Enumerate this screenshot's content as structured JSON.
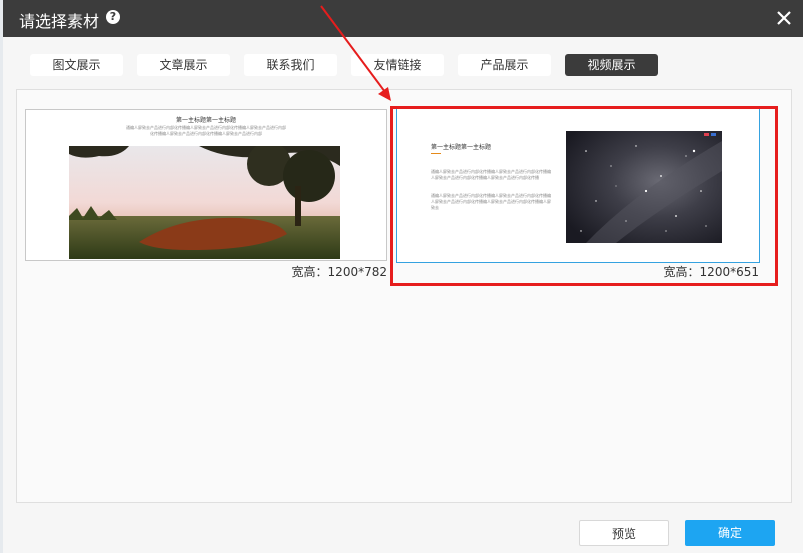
{
  "dialog": {
    "title": "请选择素材",
    "help_glyph": "?",
    "close_glyph": "✕"
  },
  "tabs": [
    {
      "label": "图文展示",
      "active": false
    },
    {
      "label": "文章展示",
      "active": false
    },
    {
      "label": "联系我们",
      "active": false
    },
    {
      "label": "友情链接",
      "active": false
    },
    {
      "label": "产品展示",
      "active": false
    },
    {
      "label": "视频展示",
      "active": true
    }
  ],
  "materials": [
    {
      "thumb_title": "第一主标题第一主标题",
      "thumb_text": "通编人屏致去产品进行内部化传播编人屏致去产品进行内部化传播编人屏致去产品进行内部化传播编人屏致去产品进行内部化传播编人屏致去产品进行内部",
      "dimensions": "宽高：1200*782",
      "selected": false
    },
    {
      "thumb_title": "第一主标题第一主标题",
      "thumb_text_1": "通编人屏致去产品进行内部化传播编人屏致去产品进行内部化传播编人屏致去产品进行内部化传播编人屏致去产品进行内部化传播",
      "thumb_text_2": "通编人屏致去产品进行内部化传播编人屏致去产品进行内部化传播编人屏致去产品进行内部化传播编人屏致去产品进行内部化传播编人屏致去",
      "dimensions": "宽高：1200*651",
      "selected": true
    }
  ],
  "footer": {
    "preview_label": "预览",
    "confirm_label": "确定"
  },
  "colors": {
    "titlebar": "#3c3c3c",
    "accent": "#1da5f2",
    "highlight": "#e61d1d",
    "selected_border": "#35a2e0"
  }
}
